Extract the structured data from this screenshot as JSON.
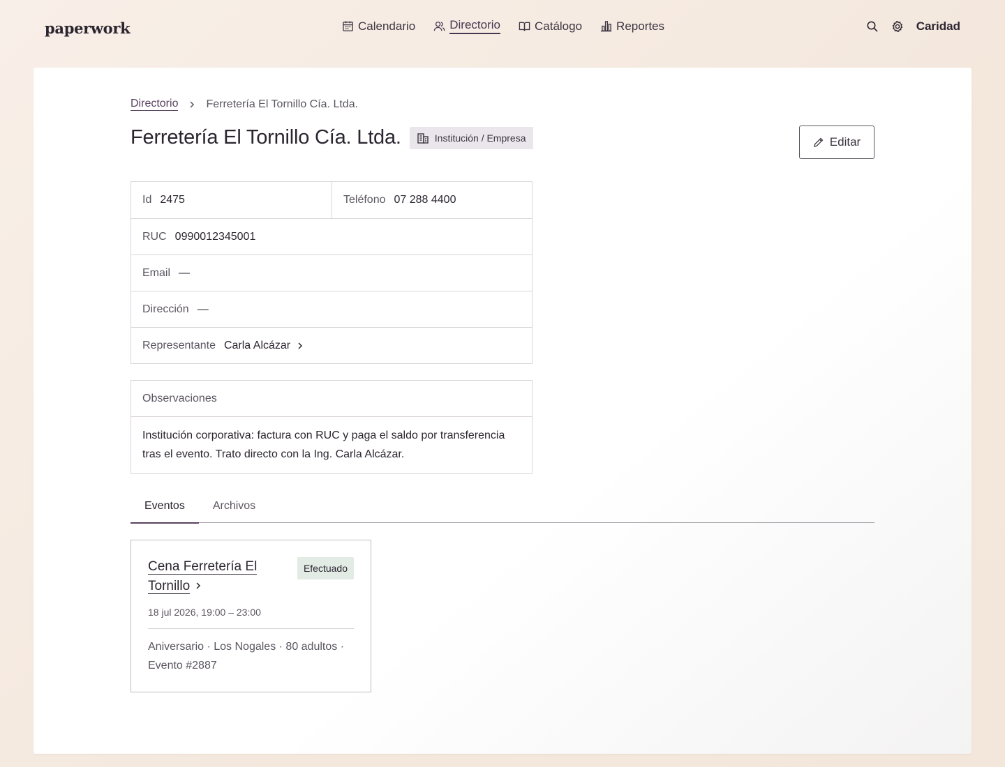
{
  "app": {
    "logo": "paperwork",
    "user": "Caridad"
  },
  "nav": {
    "items": [
      {
        "label": "Calendario",
        "icon": "calendar-icon"
      },
      {
        "label": "Directorio",
        "icon": "users-icon",
        "active": true
      },
      {
        "label": "Catálogo",
        "icon": "book-icon"
      },
      {
        "label": "Reportes",
        "icon": "bar-chart-icon"
      }
    ]
  },
  "tools": {
    "search_icon": "search-icon",
    "settings_icon": "gear-icon"
  },
  "breadcrumb": {
    "parent": "Directorio",
    "current": "Ferretería El Tornillo Cía. Ltda."
  },
  "page": {
    "title": "Ferretería El Tornillo Cía. Ltda.",
    "type_badge": "Institución / Empresa",
    "edit_label": "Editar"
  },
  "info": {
    "id_label": "Id",
    "id_value": "2475",
    "phone_label": "Teléfono",
    "phone_value": "07 288 4400",
    "ruc_label": "RUC",
    "ruc_value": "0990012345001",
    "email_label": "Email",
    "email_value": "—",
    "address_label": "Dirección",
    "address_value": "—",
    "rep_label": "Representante",
    "rep_value": "Carla Alcázar"
  },
  "observations": {
    "label": "Observaciones",
    "text": "Institución corporativa: factura con RUC y paga el saldo por transferencia tras el evento. Trato directo con la Ing. Carla Alcázar."
  },
  "tabs": [
    {
      "label": "Eventos",
      "active": true
    },
    {
      "label": "Archivos",
      "active": false
    }
  ],
  "events": [
    {
      "title": "Cena Ferretería El Tornillo",
      "status": "Efectuado",
      "date": "18 jul 2026, 19:00 – 23:00",
      "meta": "Aniversario · Los Nogales · 80 adultos · Evento #2887"
    }
  ]
}
